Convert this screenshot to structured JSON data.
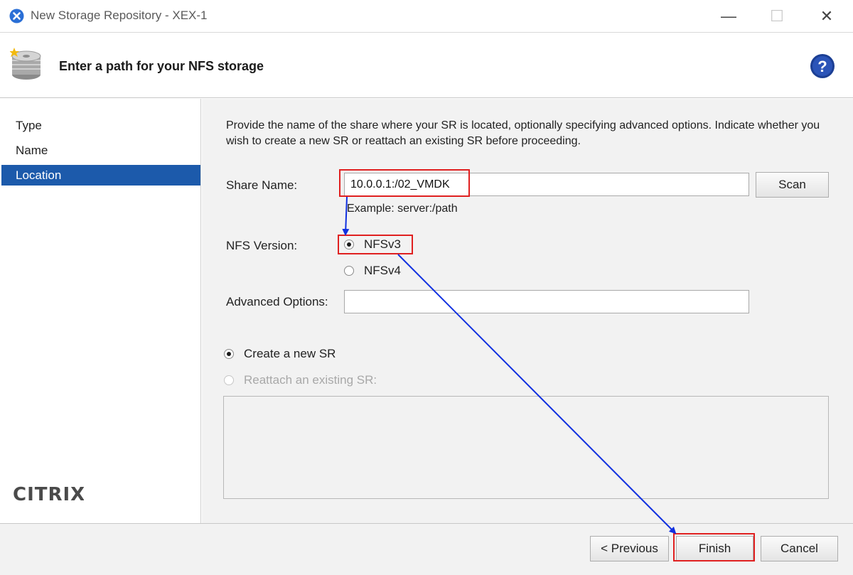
{
  "window": {
    "title": "New Storage Repository - XEX-1",
    "minimize_glyph": "—",
    "maximize_glyph": "☐",
    "close_glyph": "✕"
  },
  "header": {
    "title": "Enter a path for your NFS storage",
    "icon": "storage-disk-icon",
    "help_icon": "help-icon"
  },
  "sidebar": {
    "items": [
      {
        "label": "Type",
        "selected": false
      },
      {
        "label": "Name",
        "selected": false
      },
      {
        "label": "Location",
        "selected": true
      }
    ],
    "logo_text": "CİTRIX"
  },
  "main": {
    "description": "Provide the name of the share where your SR is located, optionally specifying advanced options. Indicate whether you wish to create a new SR or reattach an existing SR before proceeding.",
    "share_name": {
      "label": "Share Name:",
      "value": "10.0.0.1:/02_VMDK",
      "example": "Example: server:/path",
      "scan_label": "Scan"
    },
    "nfs_version": {
      "label": "NFS Version:",
      "options": [
        {
          "label": "NFSv3",
          "selected": true
        },
        {
          "label": "NFSv4",
          "selected": false
        }
      ]
    },
    "advanced_options": {
      "label": "Advanced Options:",
      "value": ""
    },
    "sr_mode": {
      "options": [
        {
          "label": "Create a new SR",
          "selected": true,
          "enabled": true
        },
        {
          "label": "Reattach an existing SR:",
          "selected": false,
          "enabled": false
        }
      ]
    }
  },
  "footer": {
    "previous_label": "< Previous",
    "finish_label": "Finish",
    "cancel_label": "Cancel"
  },
  "colors": {
    "selection": "#1c5aab",
    "annotation_box": "#e02020",
    "annotation_arrow": "#1030e0",
    "panel_bg": "#f2f2f2"
  }
}
